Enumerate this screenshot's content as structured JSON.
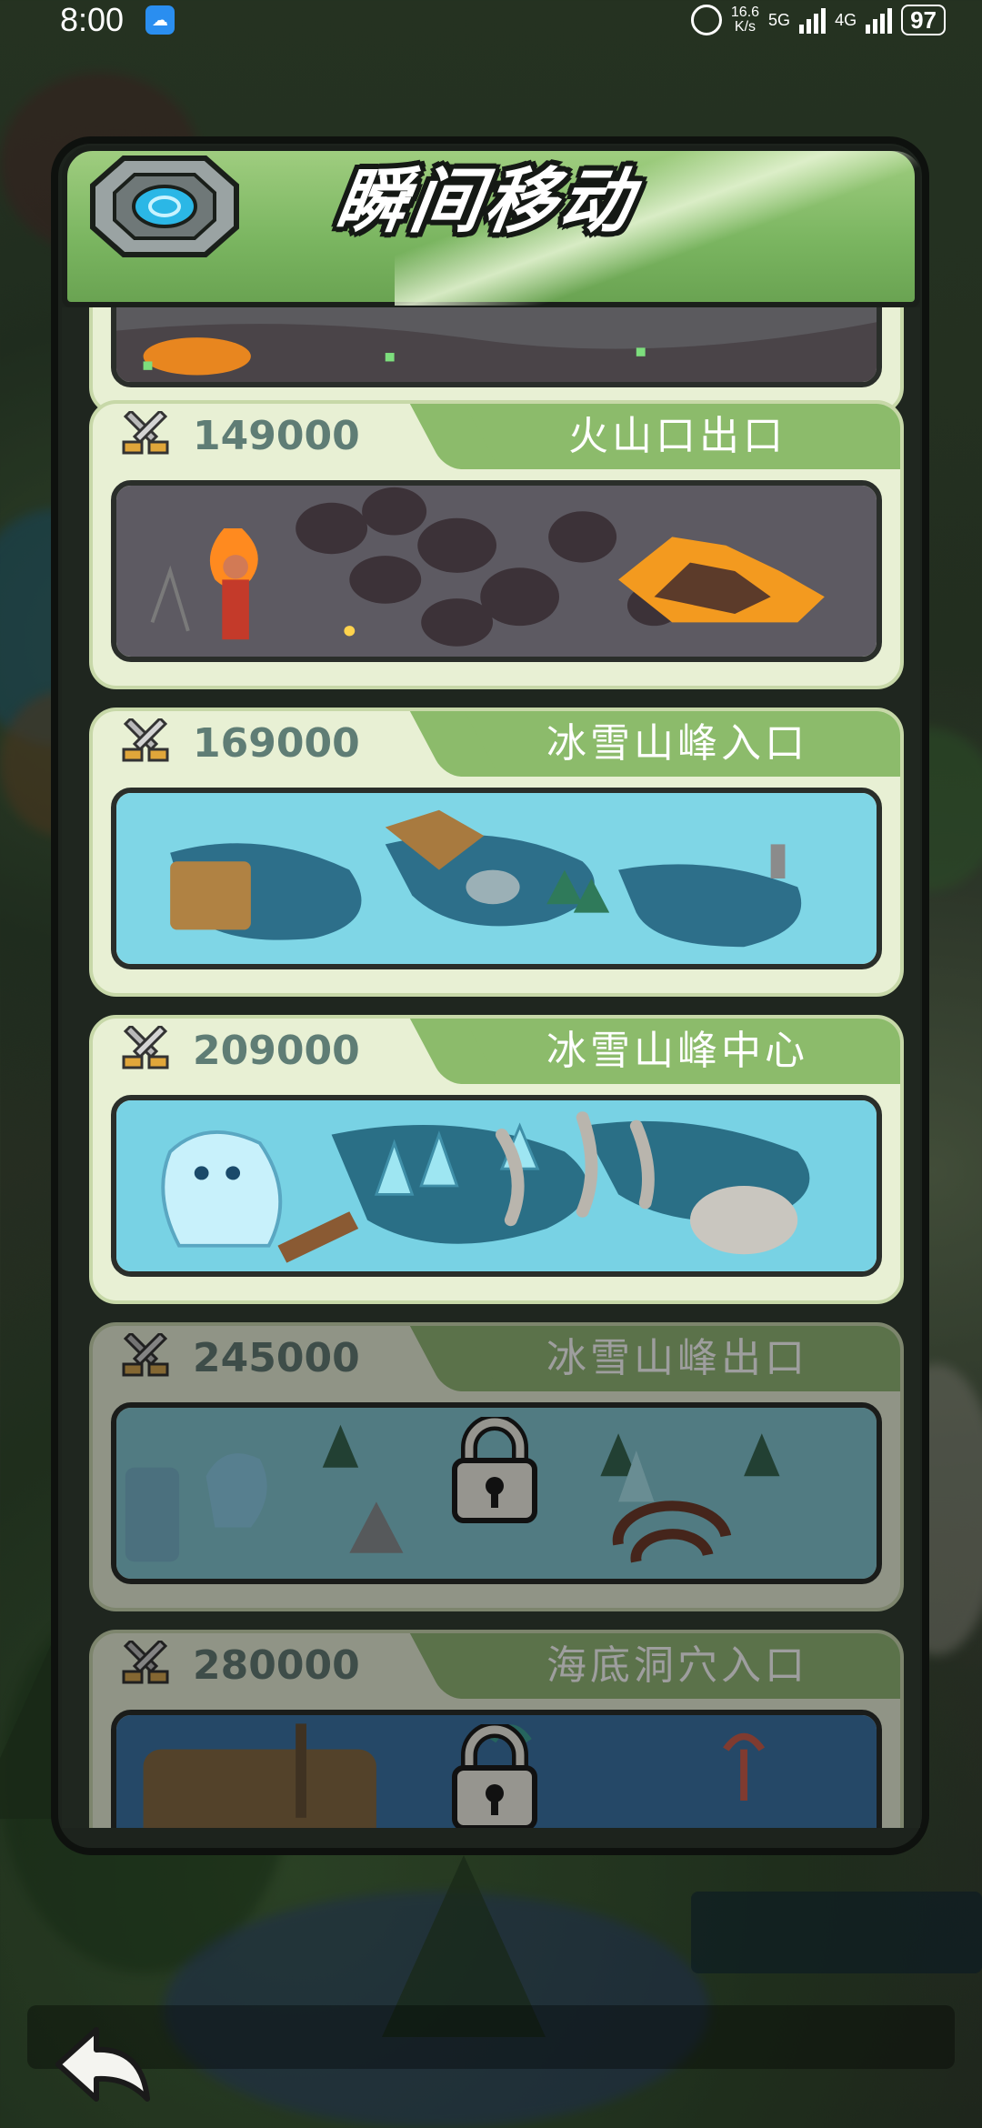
{
  "status_bar": {
    "time": "8:00",
    "speed_value": "16.6",
    "speed_unit": "K/s",
    "network_5g": "5G",
    "network_4g": "4G",
    "battery": "97"
  },
  "dialog": {
    "title": "瞬间移动",
    "header_color": "#8cbb6b",
    "destinations": [
      {
        "cost": "",
        "name": "",
        "locked": false,
        "theme": "volcano-entrance"
      },
      {
        "cost": "149000",
        "name": "火山口出口",
        "locked": false,
        "theme": "volcano"
      },
      {
        "cost": "169000",
        "name": "冰雪山峰入口",
        "locked": false,
        "theme": "ice-entrance"
      },
      {
        "cost": "209000",
        "name": "冰雪山峰中心",
        "locked": false,
        "theme": "ice-center"
      },
      {
        "cost": "245000",
        "name": "冰雪山峰出口",
        "locked": true,
        "theme": "ice-exit"
      },
      {
        "cost": "280000",
        "name": "海底洞穴入口",
        "locked": true,
        "theme": "underwater"
      }
    ]
  },
  "icons": {
    "cost": "crossed-swords-icon",
    "portal": "teleport-portal-icon",
    "lock": "lock-icon",
    "back": "back-arrow-icon"
  }
}
